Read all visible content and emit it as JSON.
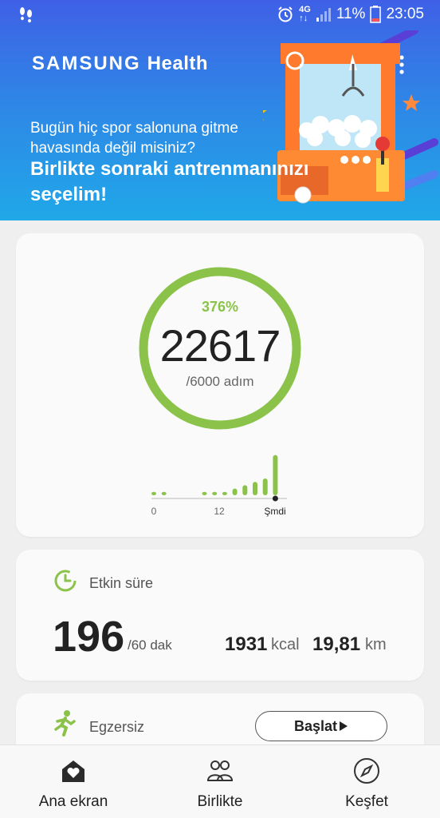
{
  "status_bar": {
    "network": "4G",
    "battery": "11%",
    "time": "23:05"
  },
  "header": {
    "brand": "SAMSUNG",
    "product": "Health",
    "promo_line_1": "Bugün hiç spor salonuna gitme havasında değil misiniz?",
    "promo_line_2": "Birlikte sonraki antrenmanınızı seçelim!"
  },
  "steps": {
    "percent": "376%",
    "value": "22617",
    "goal": "/6000 adım",
    "progress_fraction": 1.0,
    "accent_color": "#8bc34a",
    "chart": {
      "type": "bar",
      "axis_labels": [
        "0",
        "12",
        "Şmdi"
      ],
      "hourly_levels": [
        1,
        1,
        0,
        0,
        0,
        1,
        1,
        1,
        2,
        3,
        4,
        5,
        12
      ]
    }
  },
  "active": {
    "title": "Etkin süre",
    "value": "196",
    "goal": "/60 dak",
    "kcal_value": "1931",
    "kcal_unit": "kcal",
    "km_value": "19,81",
    "km_unit": "km"
  },
  "exercise": {
    "title": "Egzersiz",
    "start_label": "Başlat"
  },
  "nav": {
    "items": [
      {
        "label": "Ana ekran",
        "icon": "home-heart-icon"
      },
      {
        "label": "Birlikte",
        "icon": "people-icon"
      },
      {
        "label": "Keşfet",
        "icon": "compass-icon"
      }
    ]
  }
}
